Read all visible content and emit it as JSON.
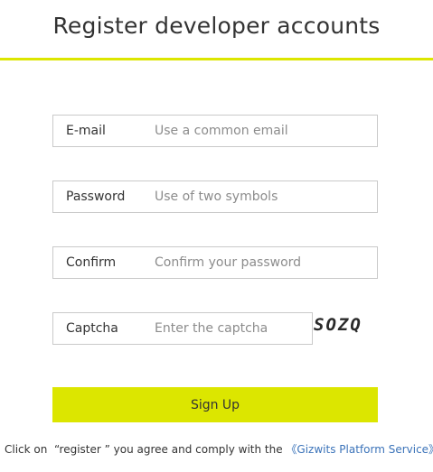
{
  "header": {
    "title": "Register developer accounts",
    "accent_color": "#dce600"
  },
  "form": {
    "email": {
      "label": "E-mail",
      "placeholder": "Use a common email",
      "value": ""
    },
    "password": {
      "label": "Password",
      "placeholder": "Use of two symbols",
      "value": ""
    },
    "confirm": {
      "label": "Confirm",
      "placeholder": "Confirm your password",
      "value": ""
    },
    "captcha": {
      "label": "Captcha",
      "placeholder": "Enter the captcha",
      "value": "",
      "image_text": "SOZQ"
    },
    "submit_label": "Sign Up"
  },
  "agreement": {
    "prefix": "Click on  “register ” you agree and comply with the ",
    "link_text": "《Gizwits Platform Service》",
    "link_color": "#3b73b9"
  }
}
